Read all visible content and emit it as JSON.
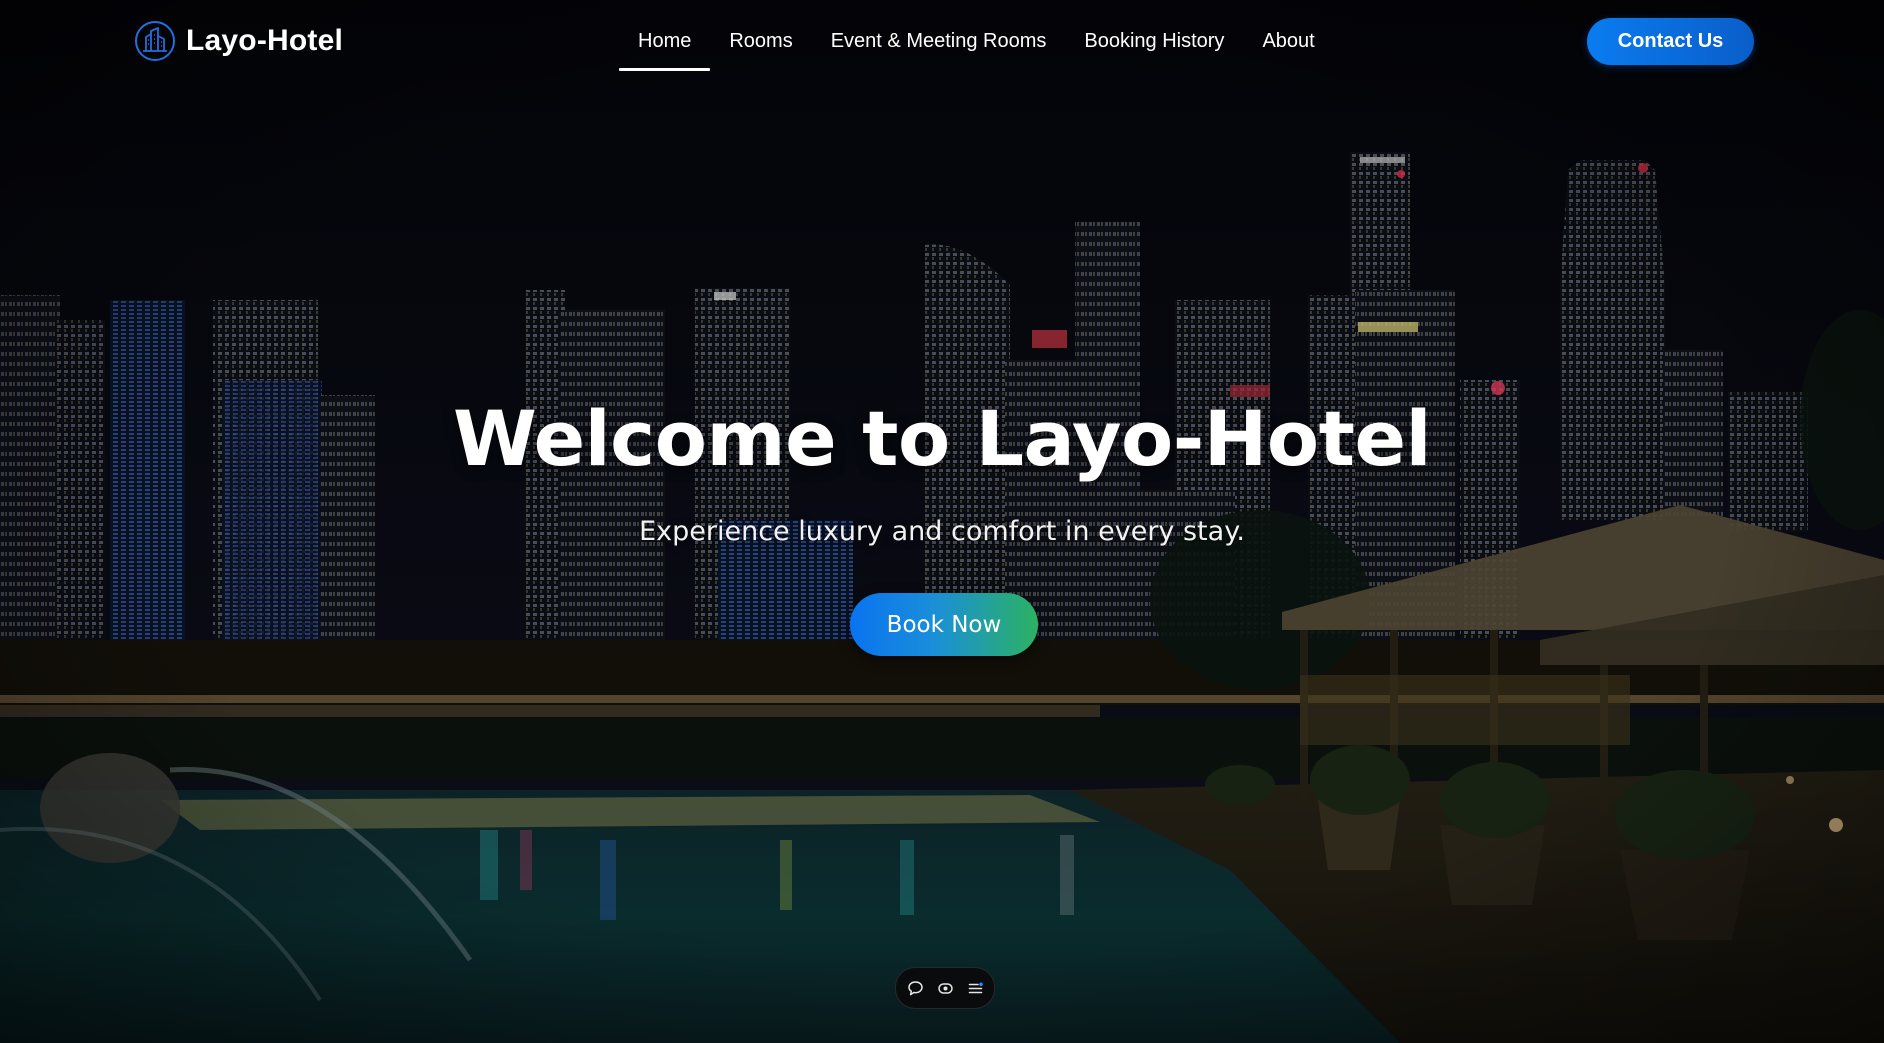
{
  "brand": {
    "name": "Layo-Hotel",
    "icon": "building-logo-icon"
  },
  "nav": {
    "items": [
      {
        "label": "Home",
        "active": true
      },
      {
        "label": "Rooms",
        "active": false
      },
      {
        "label": "Event & Meeting Rooms",
        "active": false
      },
      {
        "label": "Booking History",
        "active": false
      },
      {
        "label": "About",
        "active": false
      }
    ],
    "contact_label": "Contact Us"
  },
  "hero": {
    "title": "Welcome to Layo-Hotel",
    "subtitle": "Experience luxury and comfort in every stay.",
    "cta_label": "Book Now",
    "background": "night-city-skyline-rooftop-pool"
  },
  "toolbar": {
    "icons": [
      "comment-icon",
      "eye-icon",
      "list-menu-icon"
    ]
  },
  "colors": {
    "accent": "#0a7cf0",
    "cta_gradient_start": "#0a73f0",
    "cta_gradient_end": "#2cb262"
  }
}
